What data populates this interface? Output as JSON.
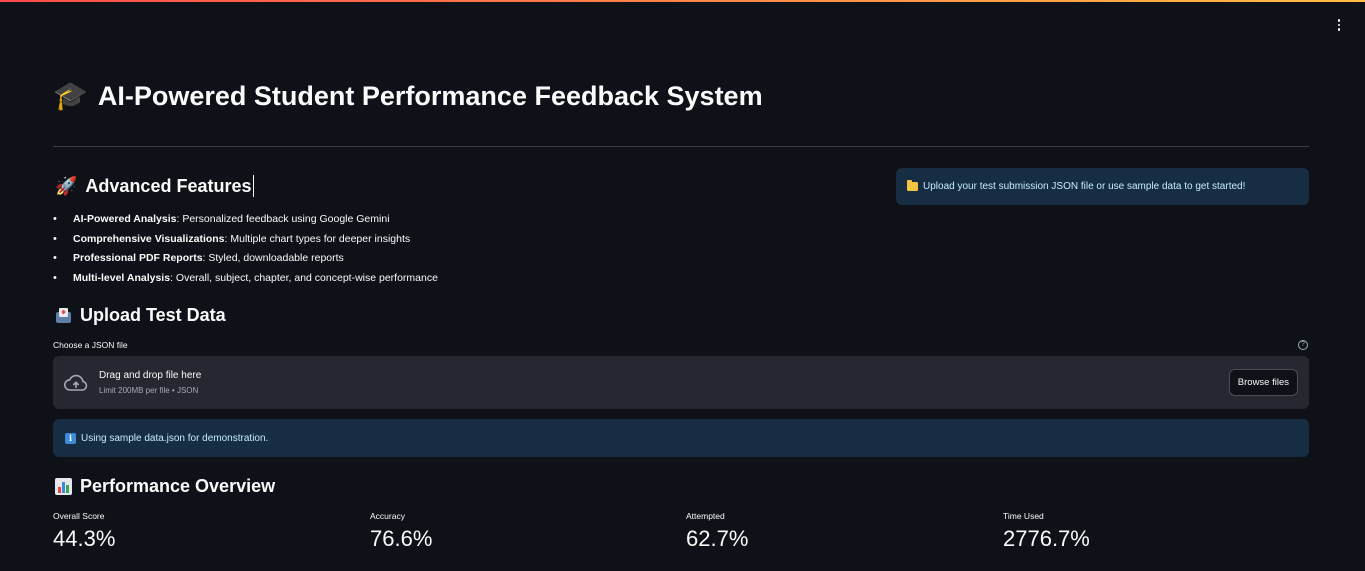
{
  "header": {
    "title_emoji": "🎓",
    "title": "AI-Powered Student Performance Feedback System"
  },
  "features": {
    "emoji": "🚀",
    "heading": "Advanced Features",
    "items": [
      {
        "bold": "AI-Powered Analysis",
        "text": ": Personalized feedback using Google Gemini"
      },
      {
        "bold": "Comprehensive Visualizations",
        "text": ": Multiple chart types for deeper insights"
      },
      {
        "bold": "Professional PDF Reports",
        "text": ": Styled, downloadable reports"
      },
      {
        "bold": "Multi-level Analysis",
        "text": ": Overall, subject, chapter, and concept-wise performance"
      }
    ]
  },
  "info_banner": {
    "icon": "folder-icon",
    "text": "Upload your test submission JSON file or use sample data to get started!"
  },
  "upload": {
    "icon": "inbox-icon",
    "heading": "Upload Test Data",
    "file_label": "Choose a JSON file",
    "help_icon": "?",
    "drop_title": "Drag and drop file here",
    "drop_subtitle": "Limit 200MB per file • JSON",
    "browse_label": "Browse files"
  },
  "sample_notice": {
    "icon": "info-icon",
    "text": "Using sample data.json for demonstration."
  },
  "performance": {
    "icon": "bar-chart-icon",
    "heading": "Performance Overview",
    "metrics": [
      {
        "label": "Overall Score",
        "value": "44.3%"
      },
      {
        "label": "Accuracy",
        "value": "76.6%"
      },
      {
        "label": "Attempted",
        "value": "62.7%"
      },
      {
        "label": "Time Used",
        "value": "2776.7%"
      }
    ]
  },
  "colors": {
    "background": "#0e1117",
    "info_bg": "#172d43",
    "info_text": "#c7ebff",
    "dropzone_bg": "#262730",
    "accent_gradient_start": "#ff4b4b",
    "accent_gradient_end": "#ffbd45"
  }
}
